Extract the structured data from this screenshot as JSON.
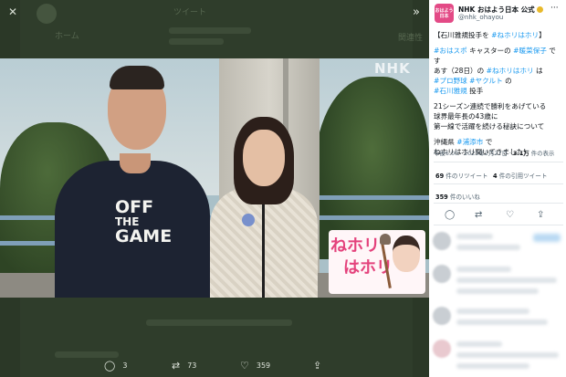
{
  "header": {
    "close_icon": "close-icon",
    "collapse_icon": "double-chevron-right-icon"
  },
  "background": {
    "title": "ツイート",
    "nav_home": "ホーム",
    "related": "関連性"
  },
  "photo": {
    "watermark": "NHK",
    "shirt_line1": "OFF",
    "shirt_line2": "THE",
    "shirt_line3": "GAME",
    "logo_line1": "ねホリ",
    "logo_line2": "はホリ"
  },
  "actions": {
    "replies": "3",
    "retweets": "73",
    "likes": "359"
  },
  "panel": {
    "avatar_text": "おはよう日本",
    "name": "NHK おはよう日本 公式",
    "handle": "@nhk_ohayou",
    "tweet": {
      "line1_pre": "【石川雅規投手を ",
      "line1_tag": "#ねホリはホリ",
      "line1_post": "】",
      "line2_tag1": "#おはスポ",
      "line2_mid": " キャスターの ",
      "line2_tag2": "#暖菜保子",
      "line2_post": " で",
      "line3": "す",
      "line4_pre": "あす（28日）の ",
      "line4_tag": "#ねホリはホリ",
      "line4_post": " は",
      "line5_tag1": "#プロ野球",
      "line5_tag2": "#ヤクルト",
      "line5_post": " の",
      "line6_tag": "#石川雅規",
      "line6_post": " 投手",
      "line7": "21シーズン連続で勝利をあげている",
      "line8": "球界最年長の43歳に",
      "line9": "第一線で活躍を続ける秘訣について",
      "line10_pre": "沖縄県 ",
      "line10_tag": "#浦添市",
      "line10_post": " で",
      "line11": "ねホリはホリ聞いてきました!"
    },
    "meta_time": "午後6:00 · 2023年2月27日 · ",
    "meta_views": "3.1万",
    "meta_views_suffix": " 件の表示",
    "retweets_count": "69",
    "retweets_label": " 件のリツイート",
    "quotes_count": "4",
    "quotes_label": " 件の引用ツイート",
    "likes_count": "359",
    "likes_label": " 件のいいね"
  }
}
